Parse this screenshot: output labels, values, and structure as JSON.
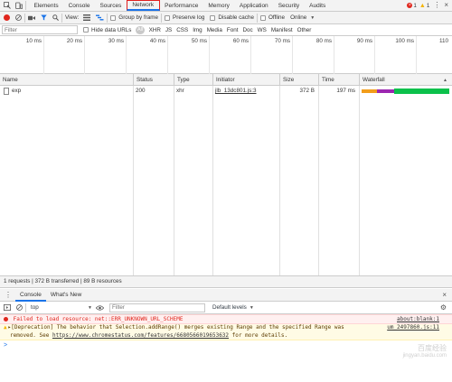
{
  "top_tabs": [
    "Elements",
    "Console",
    "Sources",
    "Network",
    "Performance",
    "Memory",
    "Application",
    "Security",
    "Audits"
  ],
  "badges": {
    "errors": "1",
    "warnings": "1"
  },
  "toolbar": {
    "view_label": "View:",
    "group_by_frame": "Group by frame",
    "preserve_log": "Preserve log",
    "disable_cache": "Disable cache",
    "offline": "Offline",
    "throttle": "Online"
  },
  "filter": {
    "placeholder": "Filter",
    "hide_data_urls": "Hide data URLs",
    "all": "All",
    "types": [
      "XHR",
      "JS",
      "CSS",
      "Img",
      "Media",
      "Font",
      "Doc",
      "WS",
      "Manifest",
      "Other"
    ]
  },
  "overview": {
    "ticks": [
      "10 ms",
      "20 ms",
      "30 ms",
      "40 ms",
      "50 ms",
      "60 ms",
      "70 ms",
      "80 ms",
      "90 ms",
      "100 ms",
      "110"
    ]
  },
  "table": {
    "columns": [
      "Name",
      "Status",
      "Type",
      "Initiator",
      "Size",
      "Time",
      "Waterfall"
    ],
    "rows": [
      {
        "name": "exp",
        "status": "200",
        "type": "xhr",
        "initiator": "jlb_13dc801.js:3",
        "size": "372 B",
        "time": "197 ms"
      }
    ]
  },
  "status_bar": "1 requests | 372 B transferred | 89 B resources",
  "drawer": {
    "tabs": [
      "Console",
      "What's New"
    ],
    "context": "top",
    "filter_placeholder": "Filter",
    "levels": "Default levels"
  },
  "console": {
    "error_text": "Failed to load resource: net::ERR_UNKNOWN_URL_SCHEME",
    "error_source": "about:blank:1",
    "warn_line1": "▸[Deprecation] The behavior that Selection.addRange() merges existing Range and the specified Range was",
    "warn_line2_prefix": "removed. See ",
    "warn_link": "https://www.chromestatus.com/features/6680566019653632",
    "warn_line2_suffix": " for more details.",
    "warn_source": "um_2497860.js:11",
    "prompt": ">"
  },
  "watermark": {
    "line1": "百度经验",
    "line2": "jingyan.baidu.com"
  },
  "colors": {
    "highlight_red": "#e02020",
    "record_red": "#e0261d",
    "accent_blue": "#1a73e8",
    "waterfall_orange": "#f29d1a",
    "waterfall_purple": "#9c27b0",
    "waterfall_green": "#0cc14b"
  }
}
